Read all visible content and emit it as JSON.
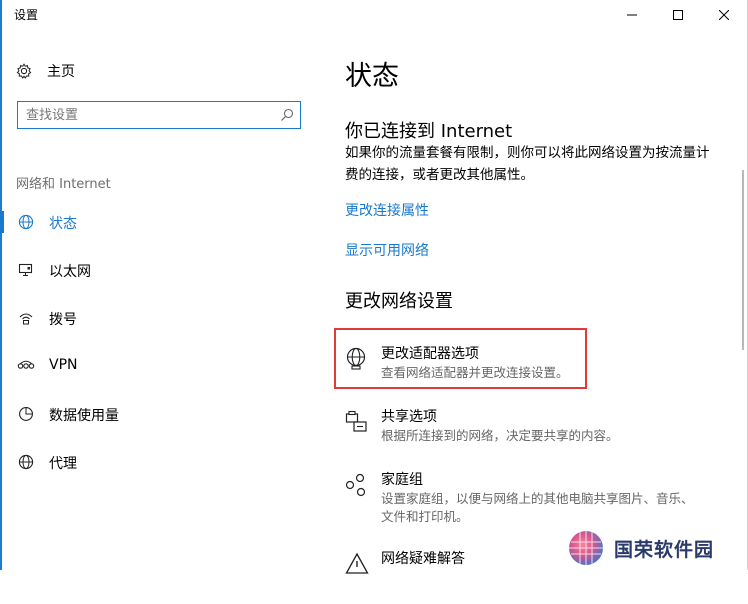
{
  "window": {
    "title": "设置"
  },
  "sidebar": {
    "home_label": "主页",
    "search_placeholder": "查找设置",
    "section_label": "网络和 Internet",
    "items": [
      {
        "label": "状态",
        "icon": "globe-icon",
        "active": true
      },
      {
        "label": "以太网",
        "icon": "ethernet-icon",
        "active": false
      },
      {
        "label": "拨号",
        "icon": "dialup-icon",
        "active": false
      },
      {
        "label": "VPN",
        "icon": "vpn-icon",
        "active": false
      },
      {
        "label": "数据使用量",
        "icon": "data-usage-icon",
        "active": false
      },
      {
        "label": "代理",
        "icon": "globe-icon",
        "active": false
      }
    ]
  },
  "main": {
    "title": "状态",
    "connected_heading": "你已连接到 Internet",
    "connected_desc_line1": "如果你的流量套餐有限制，则你可以将此网络设置为按流量计",
    "connected_desc_line2": "费的连接，或者更改其他属性。",
    "link_change_properties": "更改连接属性",
    "link_show_networks": "显示可用网络",
    "change_heading": "更改网络设置",
    "options": [
      {
        "title": "更改适配器选项",
        "desc1": "查看网络适配器并更改连接设置。",
        "desc2": "",
        "icon": "adapter-globe-icon"
      },
      {
        "title": "共享选项",
        "desc1": "根据所连接到的网络，决定要共享的内容。",
        "desc2": "",
        "icon": "sharing-icon"
      },
      {
        "title": "家庭组",
        "desc1": "设置家庭组，以便与网络上的其他电脑共享图片、音乐、",
        "desc2": "文件和打印机。",
        "icon": "homegroup-icon"
      },
      {
        "title": "网络疑难解答",
        "desc1": "",
        "desc2": "",
        "icon": "warning-icon"
      }
    ]
  },
  "watermark": {
    "text": "国荣软件园"
  },
  "colors": {
    "accent": "#1879d0",
    "highlight": "#e23a3a"
  }
}
